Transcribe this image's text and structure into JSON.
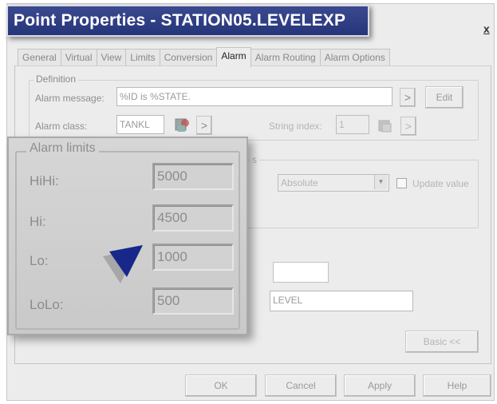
{
  "window": {
    "title": "Point Properties - STATION05.LEVELEXP",
    "close": "x"
  },
  "tabs": [
    "General",
    "Virtual",
    "View",
    "Limits",
    "Conversion",
    "Alarm",
    "Alarm Routing",
    "Alarm Options"
  ],
  "active_tab": "Alarm",
  "definition": {
    "legend": "Definition",
    "alarm_message_label": "Alarm message:",
    "alarm_message_value": "%ID is %STATE.",
    "edit_label": "Edit",
    "alarm_class_label": "Alarm class:",
    "alarm_class_value": "TANKL",
    "string_index_label": "String index:",
    "string_index_value": "1",
    "browse_glyph": ">"
  },
  "deadband": {
    "legend_fragment": "s",
    "mode_value": "Absolute",
    "update_value_label": "Update value"
  },
  "extra": {
    "tag_value": "LEVEL",
    "basic_button": "Basic <<"
  },
  "alarm_limits": {
    "legend": "Alarm limits",
    "hihi_label": "HiHi:",
    "hihi_value": "5000",
    "hi_label": "Hi:",
    "hi_value": "4500",
    "lo_label": "Lo:",
    "lo_value": "1000",
    "lolo_label": "LoLo:",
    "lolo_value": "500"
  },
  "buttons": {
    "ok": "OK",
    "cancel": "Cancel",
    "apply": "Apply",
    "help": "Help"
  },
  "colors": {
    "title_bar": "#2e3d84",
    "zoom_arrow": "#17288a"
  }
}
